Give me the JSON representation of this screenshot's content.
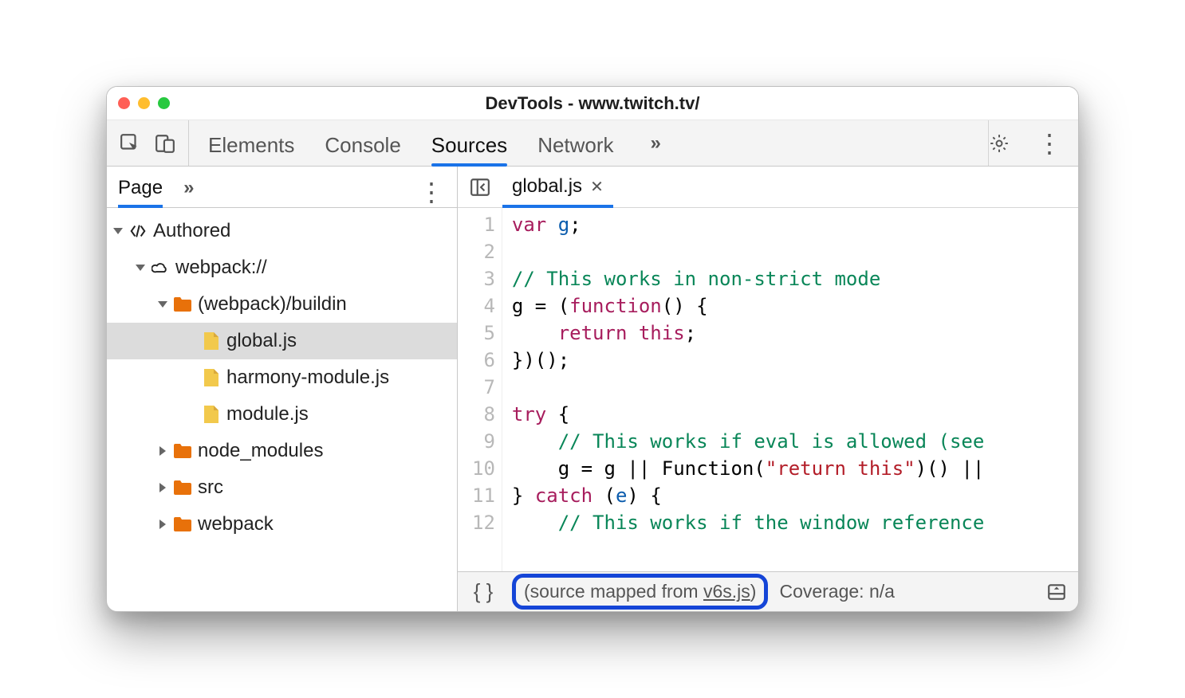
{
  "window": {
    "title": "DevTools - www.twitch.tv/"
  },
  "main_tabs": {
    "items": [
      "Elements",
      "Console",
      "Sources",
      "Network"
    ],
    "more": "»",
    "active_index": 2
  },
  "sidebar": {
    "tabs": {
      "items": [
        "Page"
      ],
      "more": "»",
      "active_index": 0
    },
    "tree": {
      "root": "Authored",
      "domain": "webpack://",
      "open_folder": "(webpack)/buildin",
      "files": [
        "global.js",
        "harmony-module.js",
        "module.js"
      ],
      "collapsed_folders": [
        "node_modules",
        "src",
        "webpack"
      ],
      "selected_file_index": 0
    }
  },
  "editor": {
    "open_tab": "global.js",
    "line_numbers": [
      "1",
      "2",
      "3",
      "4",
      "5",
      "6",
      "7",
      "8",
      "9",
      "10",
      "11",
      "12"
    ],
    "code": {
      "l1_kw": "var",
      "l1_var": "g",
      "l1_rest": ";",
      "l3": "// This works in non-strict mode",
      "l4_pre": "g = (",
      "l4_fn": "function",
      "l4_post": "() {",
      "l5_kw": "return",
      "l5_this": "this",
      "l5_rest": ";",
      "l6": "})();",
      "l8_kw": "try",
      "l8_rest": " {",
      "l9": "// This works if eval is allowed (see",
      "l10_pre": "g = g || Function(",
      "l10_str": "\"return this\"",
      "l10_post": ")() ||",
      "l11_pre": "} ",
      "l11_kw": "catch",
      "l11_post": " (",
      "l11_var": "e",
      "l11_end": ") {",
      "l12": "// This works if the window reference"
    }
  },
  "statusbar": {
    "format_label": "{ }",
    "mapped_prefix": "(source mapped from ",
    "mapped_link": "v6s.js",
    "mapped_suffix": ")",
    "coverage": "Coverage: n/a"
  }
}
